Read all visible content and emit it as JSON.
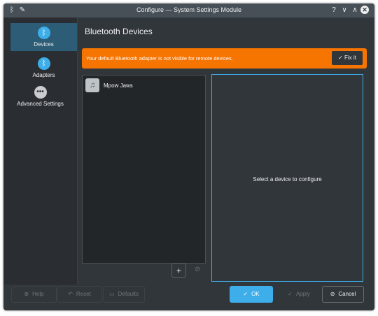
{
  "window": {
    "title": "Configure — System Settings Module"
  },
  "titlebar": {
    "help": "?",
    "minimize": "∨",
    "maximize": "∧",
    "close": "✕"
  },
  "sidebar": {
    "items": [
      {
        "label": "Devices",
        "icon": "bluetooth-icon",
        "selected": true
      },
      {
        "label": "Adapters",
        "icon": "bluetooth-icon",
        "selected": false
      },
      {
        "label": "Advanced Settings",
        "icon": "more-icon",
        "selected": false
      }
    ]
  },
  "main": {
    "heading": "Bluetooth Devices",
    "banner": {
      "message": "Your default Bluetooth adapter is not visible for remote devices.",
      "fix_label": "Fix it",
      "color": "#f67400"
    },
    "devices": [
      {
        "name": "Mpow Jaws",
        "icon": "music-device-icon"
      }
    ],
    "placeholder": "Select a device to configure"
  },
  "buttons": {
    "help": "Help",
    "reset": "Reset",
    "defaults": "Defaults",
    "ok": "OK",
    "apply": "Apply",
    "cancel": "Cancel"
  },
  "colors": {
    "accent": "#3daee9",
    "background": "#31363b",
    "sidebar": "#2a2e32"
  }
}
